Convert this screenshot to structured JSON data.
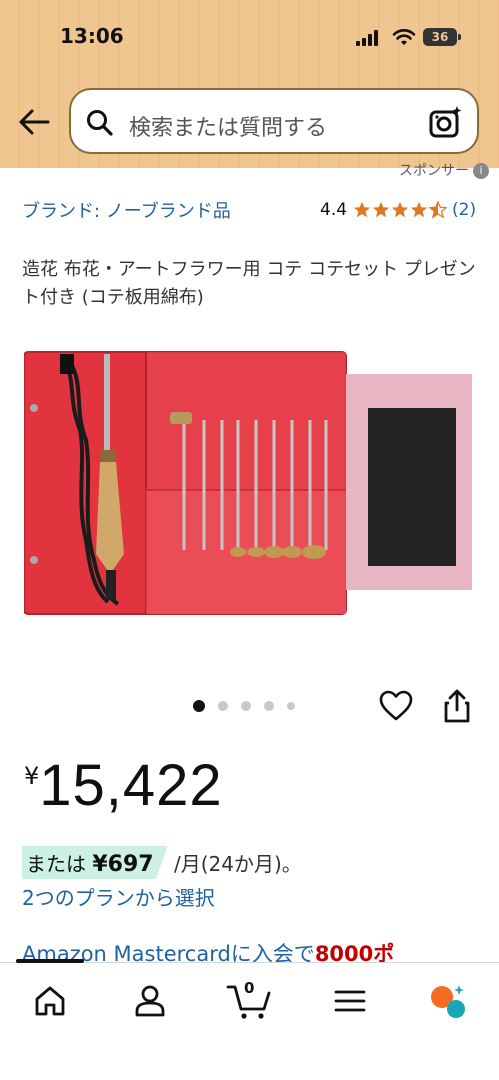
{
  "status_bar": {
    "time": "13:06",
    "battery": "36"
  },
  "search": {
    "placeholder": "検索または質問する"
  },
  "sponsor": {
    "label": "スポンサー"
  },
  "product": {
    "brand": "ブランド: ノーブランド品",
    "rating_value": "4.4",
    "rating_count": "(2)",
    "stars": 4.4,
    "title": "造花 布花・アートフラワー用 コテ コテセット プレゼント付き (コテ板用綿布)",
    "image_count": 5,
    "active_image": 1
  },
  "price": {
    "currency": "¥",
    "value": "15,422"
  },
  "installment": {
    "prefix": "または",
    "amount": "¥697",
    "suffix": "/月(24か月)。",
    "plan_link": "2つのプランから選択"
  },
  "promo": {
    "text": "Amazon Mastercardに入会で",
    "highlight": "8000ポ"
  },
  "nav": {
    "cart_count": "0"
  },
  "colors": {
    "header": "#f0c690",
    "link": "#2162a1",
    "installment_bg": "#cdf0e5",
    "star": "#de7921"
  }
}
